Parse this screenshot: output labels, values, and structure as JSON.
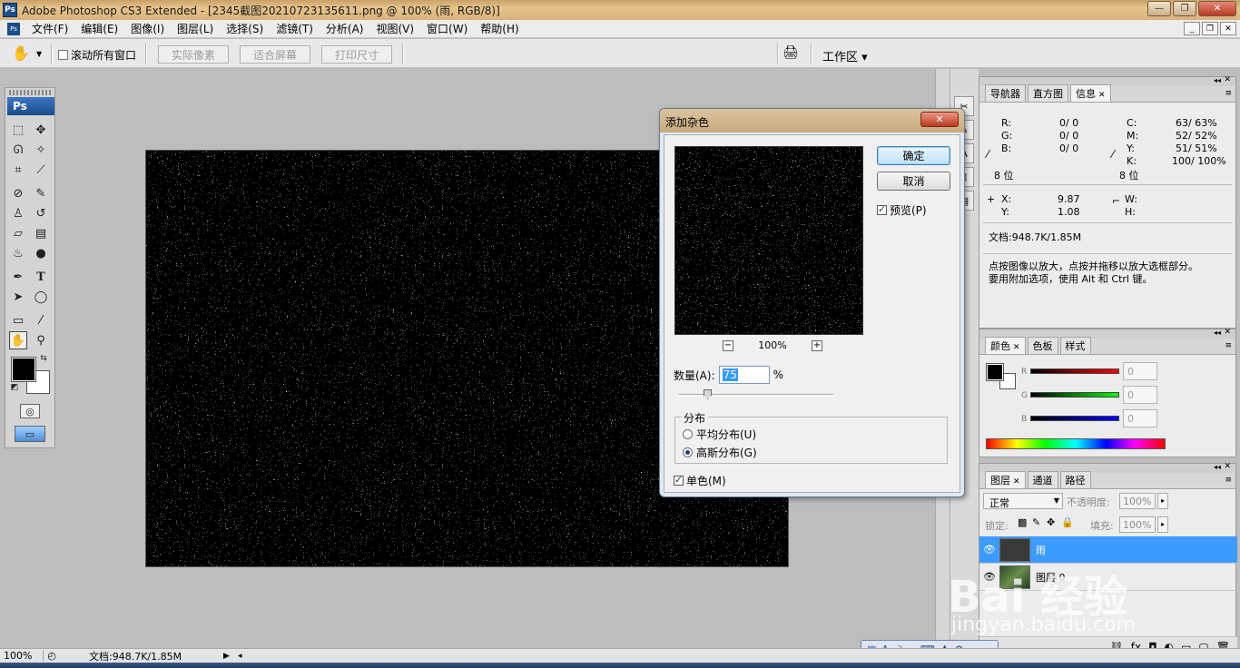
{
  "window": {
    "title": "Adobe Photoshop CS3 Extended - [2345截图20210723135611.png @ 100% (雨, RGB/8)]",
    "logo": "Ps"
  },
  "menu": [
    "文件(F)",
    "编辑(E)",
    "图像(I)",
    "图层(L)",
    "选择(S)",
    "滤镜(T)",
    "分析(A)",
    "视图(V)",
    "窗口(W)",
    "帮助(H)"
  ],
  "options": {
    "scroll_all_label": "滚动所有窗口",
    "actual_pixels": "实际像素",
    "fit_screen": "适合屏幕",
    "print_size": "打印尺寸",
    "workspace": "工作区 ▾"
  },
  "toolbox": {
    "logo": "Ps",
    "foreground_color": "#000000",
    "background_color": "#ffffff"
  },
  "dialog": {
    "title": "添加杂色",
    "ok": "确定",
    "cancel": "取消",
    "preview_label": "预览(P)",
    "preview_checked": true,
    "zoom": "100%",
    "amount_label": "数量(A):",
    "amount_value": "75",
    "amount_unit": "%",
    "distribution_label": "分布",
    "uniform_label": "平均分布(U)",
    "gaussian_label": "高斯分布(G)",
    "selected_distribution": "gaussian",
    "monochrome_label": "单色(M)",
    "monochrome_checked": true
  },
  "info_panel": {
    "tabs": [
      "导航器",
      "直方图",
      "信息"
    ],
    "active_tab": "信息",
    "r_label": "R:",
    "r_value": "0/  0",
    "g_label": "G:",
    "g_value": "0/  0",
    "b_label": "B:",
    "b_value": "0/  0",
    "bits_left": "8 位",
    "c_label": "C:",
    "c_value": "63/  63%",
    "m_label": "M:",
    "m_value": "52/  52%",
    "y_label": "Y:",
    "y_value": "51/  51%",
    "k_label": "K:",
    "k_value": "100/ 100%",
    "bits_right": "8 位",
    "x_label": "X:",
    "x_value": "9.87",
    "y2_label": "Y:",
    "y2_value": "1.08",
    "w_label": "W:",
    "h_label": "H:",
    "doc_size": "文档:948.7K/1.85M",
    "hint_line1": "点按图像以放大，点按并拖移以放大选框部分。",
    "hint_line2": "要用附加选项，使用 Alt 和 Ctrl 键。"
  },
  "color_panel": {
    "tabs": [
      "颜色",
      "色板",
      "样式"
    ],
    "active_tab": "颜色",
    "r_label": "R",
    "g_label": "G",
    "b_label": "B",
    "r_value": "0",
    "g_value": "0",
    "b_value": "0"
  },
  "layers_panel": {
    "tabs": [
      "图层",
      "通道",
      "路径"
    ],
    "active_tab": "图层",
    "blend_mode": "正常",
    "opacity_label": "不透明度:",
    "opacity_value": "100%",
    "lock_label": "锁定:",
    "fill_label": "填充:",
    "fill_value": "100%",
    "layers": [
      {
        "name": "雨",
        "selected": true
      },
      {
        "name": "图层 0",
        "selected": false
      }
    ]
  },
  "statusbar": {
    "zoom": "100%",
    "doc": "文档:948.7K/1.85M"
  },
  "watermark": {
    "main": "Bai 经验",
    "url": "jingyan.baidu.com"
  }
}
